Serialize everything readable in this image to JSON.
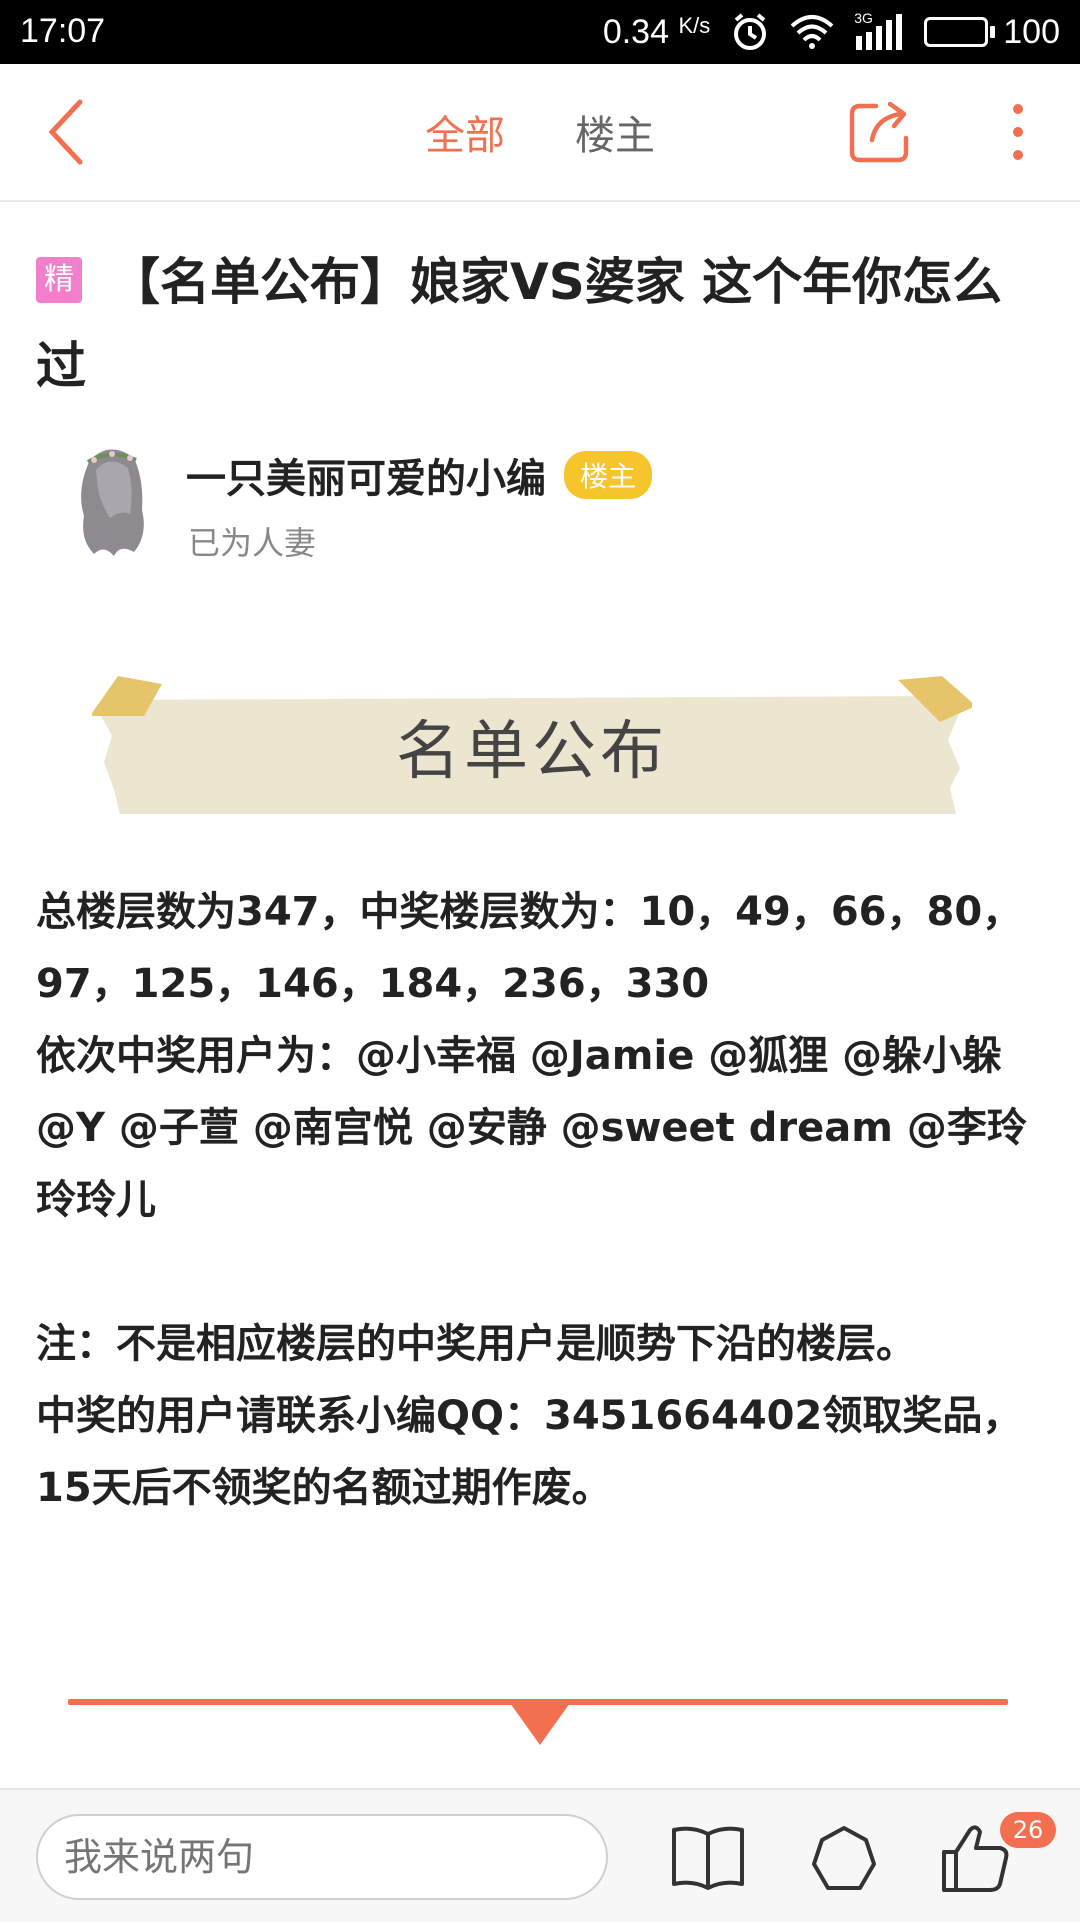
{
  "status_bar": {
    "time": "17:07",
    "speed_value": "0.34",
    "speed_unit": "K/s",
    "network_label": "3G",
    "battery": "100",
    "battery_color": "#f0b92a"
  },
  "header": {
    "tabs": [
      {
        "label": "全部",
        "active": true
      },
      {
        "label": "楼主",
        "active": false
      }
    ],
    "accent_color": "#f2704f"
  },
  "post": {
    "badge": "精",
    "title": "【名单公布】娘家VS婆家 这个年你怎么过",
    "author": {
      "name": "一只美丽可爱的小编",
      "badge": "楼主",
      "status": "已为人妻"
    },
    "banner_text": "名单公布",
    "paragraphs": [
      "总楼层数为347，中奖楼层数为：10，49，66，80，97，125，146，184，236，330",
      "依次中奖用户为：@小幸福 @Jamie @狐狸 @躲小躲 @Y @子萱 @南宫悦 @安静 @sweet dream @李玲玲玲儿",
      "",
      "注：不是相应楼层的中奖用户是顺势下沿的楼层。",
      "中奖的用户请联系小编QQ：3451664402领取奖品，15天后不领奖的名额过期作废。"
    ]
  },
  "bottom_bar": {
    "comment_placeholder": "我来说两句",
    "like_count": "26"
  }
}
